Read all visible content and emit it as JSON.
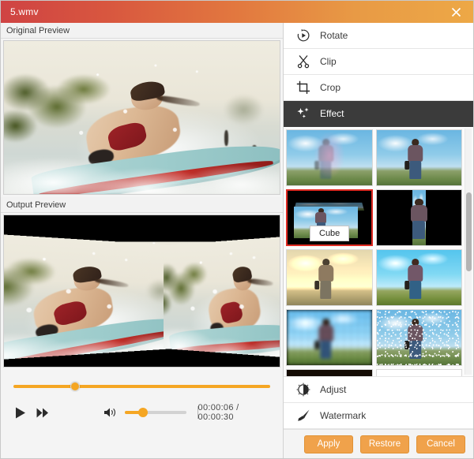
{
  "window": {
    "title": "5.wmv",
    "close_icon": "close-icon",
    "accent_orange": "#f0a24b",
    "title_gradient_from": "#cf4343",
    "title_gradient_to": "#eda846",
    "selection_border": "#e02a22",
    "active_menu_bg": "#3b3b3b"
  },
  "preview": {
    "original_label": "Original Preview",
    "output_label": "Output Preview"
  },
  "player": {
    "play_icon": "play-icon",
    "fast_forward_icon": "fast-forward-icon",
    "volume_icon": "volume-icon",
    "timeline_percent": 24,
    "volume_percent": 30,
    "current_time": "00:00:06",
    "total_time": "00:00:30",
    "time_separator": "/",
    "time_display": "00:00:06 / 00:00:30"
  },
  "menu": {
    "items": [
      {
        "label": "Rotate",
        "icon": "rotate-icon",
        "active": false
      },
      {
        "label": "Clip",
        "icon": "scissors-icon",
        "active": false
      },
      {
        "label": "Crop",
        "icon": "crop-icon",
        "active": false
      },
      {
        "label": "Effect",
        "icon": "sparkle-icon",
        "active": true
      }
    ],
    "bottom_items": [
      {
        "label": "Adjust",
        "icon": "brightness-icon"
      },
      {
        "label": "Watermark",
        "icon": "brush-icon"
      }
    ]
  },
  "effects": {
    "tooltip": "Cube",
    "selected_index": 2,
    "scrollbar_thumb_top_percent": 26,
    "scrollbar_thumb_height_percent": 32,
    "thumbnails": [
      {
        "name": "ghost",
        "variant": "v-ghost"
      },
      {
        "name": "original",
        "variant": "v-normal"
      },
      {
        "name": "cube",
        "variant": "v-cube"
      },
      {
        "name": "letterbox",
        "variant": "v-black"
      },
      {
        "name": "sepia",
        "variant": "v-sepia"
      },
      {
        "name": "cool",
        "variant": "v-cool"
      },
      {
        "name": "pixelate",
        "variant": "v-pixel"
      },
      {
        "name": "noise",
        "variant": "v-noise"
      },
      {
        "name": "glow",
        "variant": "v-glow"
      },
      {
        "name": "sketch",
        "variant": "v-sketch"
      }
    ]
  },
  "footer": {
    "apply_label": "Apply",
    "restore_label": "Restore",
    "cancel_label": "Cancel"
  }
}
